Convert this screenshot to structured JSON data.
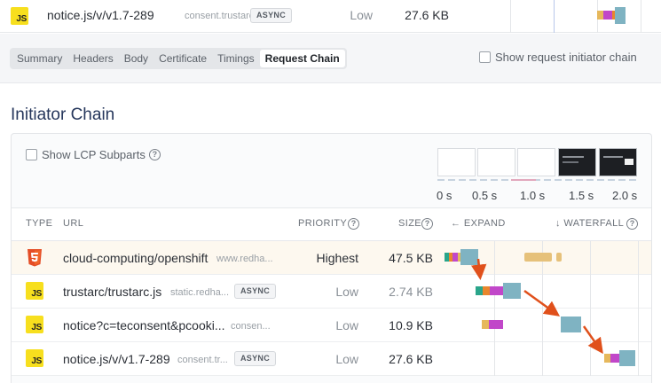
{
  "top_row": {
    "url": "notice.js/v/v1.7-289",
    "host": "consent.trustarc....",
    "badge": "ASYNC",
    "priority": "Low",
    "size": "27.6 KB"
  },
  "tabs": [
    "Summary",
    "Headers",
    "Body",
    "Certificate",
    "Timings",
    "Request Chain"
  ],
  "active_tab": "Request Chain",
  "show_initiator_label": "Show request initiator chain",
  "section_title": "Initiator Chain",
  "lcp_label": "Show LCP Subparts",
  "info_glyph": "?",
  "time_ticks": [
    "0 s",
    "0.5 s",
    "1.0 s",
    "1.5 s",
    "2.0 s"
  ],
  "columns": {
    "type": "TYPE",
    "url": "URL",
    "priority": "PRIORITY",
    "size": "SIZE",
    "expand": "← EXPAND",
    "waterfall": "↓ WATERFALL"
  },
  "rows": [
    {
      "type": "html",
      "url": "cloud-computing/openshift",
      "host": "www.redha...",
      "badge": "",
      "priority": "Highest",
      "size": "47.5 KB"
    },
    {
      "type": "js",
      "url": "trustarc/trustarc.js",
      "host": "static.redha...",
      "badge": "ASYNC",
      "priority": "Low",
      "size": "2.74 KB"
    },
    {
      "type": "js",
      "url": "notice?c=teconsent&pcooki...",
      "host": "consen...",
      "badge": "",
      "priority": "Low",
      "size": "10.9 KB"
    },
    {
      "type": "js",
      "url": "notice.js/v/v1.7-289",
      "host": "consent.tr...",
      "badge": "ASYNC",
      "priority": "Low",
      "size": "27.6 KB"
    }
  ],
  "icons": {
    "js": "js-file-icon",
    "html": "html5-icon",
    "arrow": "initiator-arrow-icon"
  },
  "colors": {
    "accent_title": "#26375c",
    "arrow": "#e0501b",
    "bar_dns": "#2aa58a",
    "bar_connect": "#e9862c",
    "bar_ssl": "#c147c9",
    "bar_wait": "#e6b85c",
    "bar_download": "#7fb3c2",
    "highlight_row": "#fdf8ef"
  }
}
